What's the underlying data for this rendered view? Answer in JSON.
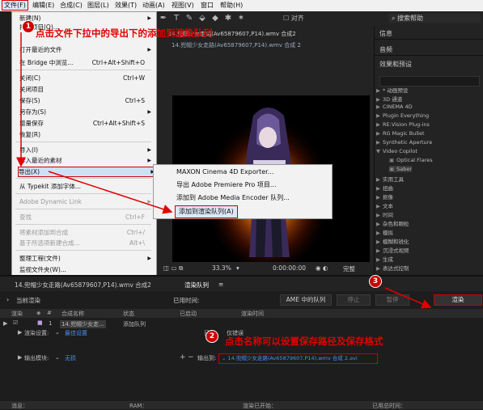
{
  "menubar": {
    "items": [
      "文件(F)",
      "编辑(E)",
      "合成(C)",
      "图层(L)",
      "效果(T)",
      "动画(A)",
      "视图(V)",
      "窗口",
      "帮助(H)"
    ]
  },
  "toolbar": {
    "snap_label": "对齐",
    "search_placeholder": "搜索帮助"
  },
  "file_menu": {
    "items": [
      {
        "label": "新建(N)",
        "shortcut": "",
        "arrow": true
      },
      {
        "label": "打开项目(O)...",
        "shortcut": ""
      },
      {
        "label": "打开最近的文件",
        "shortcut": "",
        "arrow": true
      },
      {
        "label": "在 Bridge 中浏览...",
        "shortcut": "Ctrl+Alt+Shift+O"
      },
      {
        "label": "关闭(C)",
        "shortcut": "Ctrl+W"
      },
      {
        "label": "关闭项目",
        "shortcut": ""
      },
      {
        "label": "保存(S)",
        "shortcut": "Ctrl+S"
      },
      {
        "label": "另存为(S)",
        "shortcut": "",
        "arrow": true
      },
      {
        "label": "增量保存",
        "shortcut": "Ctrl+Alt+Shift+S"
      },
      {
        "label": "恢复(R)",
        "shortcut": ""
      },
      {
        "label": "导入(I)",
        "shortcut": "",
        "arrow": true
      },
      {
        "label": "导入最近的素材",
        "shortcut": "",
        "arrow": true
      },
      {
        "label": "导出(X)",
        "shortcut": "",
        "arrow": true
      },
      {
        "label": "从 Typekit 添加字体...",
        "shortcut": ""
      },
      {
        "label": "Adobe Dynamic Link",
        "shortcut": "",
        "arrow": true,
        "disabled": true
      },
      {
        "label": "查找",
        "shortcut": "Ctrl+F"
      },
      {
        "label": "将素材添加到合成",
        "shortcut": "Ctrl+/"
      },
      {
        "label": "基于所选项新建合成...",
        "shortcut": "Alt+\\"
      },
      {
        "label": "整理工程(文件)",
        "shortcut": "",
        "arrow": true
      },
      {
        "label": "监视文件夹(W)...",
        "shortcut": ""
      }
    ]
  },
  "export_submenu": {
    "items": [
      "MAXON Cinema 4D Exporter...",
      "导出 Adobe Premiere Pro 项目...",
      "添加到 Adobe Media Encoder 队列...",
      "添加到渲染队列(A)"
    ]
  },
  "comp": {
    "tab_title": "14.兜帽少女走路(Av65879607,P14).wmv 合成2",
    "tab_sub": "14.兜帽少女走路(Av65879607,P14).wmv  合成 2",
    "zoom": "33.3%",
    "timecode": "0:00:00:00",
    "quality": "完整"
  },
  "right_panel": {
    "info": "信息",
    "audio": "音频",
    "effects_title": "效果和预设",
    "tree": [
      "* 动画预设",
      "3D 通道",
      "CINEMA 4D",
      "Plugin Everything",
      "RE:Vision Plug-ins",
      "RG Magic Bullet",
      "Synthetic Aperture",
      "Video Copilot",
      "Optical Flares",
      "Saber",
      "实用工具",
      "扭曲",
      "抠像",
      "文本",
      "时间",
      "杂色和颗粒",
      "模拟",
      "模糊和锐化",
      "沉浸式视频",
      "生成",
      "表达式控制"
    ]
  },
  "bottom": {
    "tab1": "14.兜帽少女走路(Av65879607,P14).wmv 合成2",
    "tab2": "渲染队列",
    "current_render": "当前渲染",
    "elapsed": "已用时间:",
    "ame_queue": "AME 中的队列",
    "stop": "停止",
    "pause": "暂停",
    "render": "渲染",
    "columns": [
      "渲染",
      "#",
      "合成名称",
      "状态",
      "已启动",
      "渲染时间"
    ],
    "row_num": "1",
    "row_comp": "14.兜帽少女走...",
    "row_status": "添加队列",
    "render_settings_label": "渲染设置:",
    "render_settings_value": "最佳设置",
    "log_label": "日志:",
    "log_value": "仅错误",
    "output_module_label": "输出模块:",
    "output_module_value": "无损",
    "output_to_label": "输出到:",
    "output_path": "14.兜帽少女走路(Av65879607,P14).wmv 合成 2.avi",
    "footer_cols": [
      "消息：",
      "RAM：",
      "渲染已开始：",
      "已用总时间："
    ]
  },
  "annotations": {
    "step1": "点击文件下拉中的导出下的添加到渲染队列",
    "step2": "点击名称可以设置保存路径及保存格式",
    "n1": "1",
    "n2": "2",
    "n3": "3",
    "color": "#e00000"
  },
  "colors": {
    "highlight_border": "#cc0000",
    "link_blue": "#4a8ef0",
    "panel_bg": "#232323"
  }
}
